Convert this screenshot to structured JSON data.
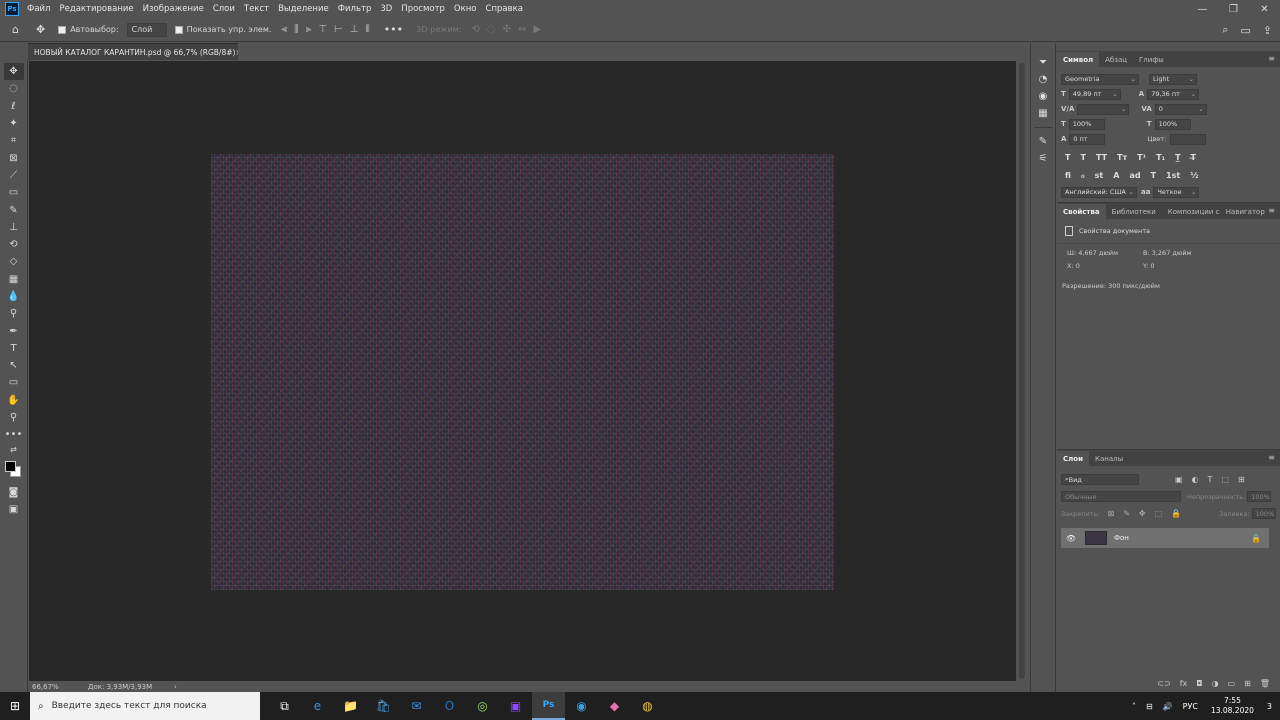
{
  "app": {
    "logo": "Ps"
  },
  "menu": [
    "Файл",
    "Редактирование",
    "Изображение",
    "Слои",
    "Текст",
    "Выделение",
    "Фильтр",
    "3D",
    "Просмотр",
    "Окно",
    "Справка"
  ],
  "window_controls": {
    "minimize": "—",
    "restore": "❐",
    "close": "✕"
  },
  "options": {
    "home_icon": "⌂",
    "move_icon": "✥",
    "autoselect_label": "Автовыбор:",
    "autoselect_value": "Слой",
    "show_controls_label": "Показать упр. элем.",
    "more": "•••",
    "mode_3d": "3D-режим:",
    "search_icon": "⌕",
    "workspace_icon": "▭",
    "share_icon": "⇪"
  },
  "document": {
    "tab_title": "НОВЫЙ КАТАЛОГ КАРАНТИН.psd @ 66,7% (RGB/8#)",
    "close": "×",
    "zoom": "66,67%",
    "doc_info": "Док: 3,93M/3,93M",
    "arrow": "›"
  },
  "character": {
    "tabs": [
      "Символ",
      "Абзац",
      "Глифы"
    ],
    "font_family": "Geometria",
    "font_style": "Light",
    "font_size": "49,89 пт",
    "leading": "79,36 пт",
    "kerning": "",
    "tracking": "0",
    "vertical_scale": "100%",
    "horizontal_scale": "100%",
    "baseline_shift": "0 пт",
    "color_label": "Цвет:",
    "language": "Английский: США",
    "antialias_icon": "aa",
    "antialias": "Четкое",
    "labels": {
      "size": "T",
      "leading": "A",
      "kerning": "V/A",
      "tracking": "VA",
      "vscale": "T",
      "hscale": "T",
      "baseline": "A"
    },
    "typo_row1": [
      "T",
      "T",
      "TT",
      "Tт",
      "T¹",
      "T₁",
      "T̲",
      "T̶"
    ],
    "typo_row2": [
      "fi",
      "ℴ",
      "st",
      "A",
      "ad",
      "T",
      "1st",
      "½"
    ]
  },
  "properties": {
    "tabs": [
      "Свойства",
      "Библиотеки",
      "Композиции слоев",
      "Навигатор"
    ],
    "heading": "Свойства документа",
    "width": "Ш:  4,667 дюйм",
    "height": "В:  3,267 дюйм",
    "x": "X:  0",
    "y": "Y:  0",
    "resolution": "Разрешение: 300 пикс/дюйм"
  },
  "layers": {
    "tabs": [
      "Слои",
      "Каналы"
    ],
    "search_placeholder": "Вид",
    "blend_mode": "Обычные",
    "opacity_label": "Непрозрачность:",
    "opacity": "100%",
    "lock_label": "Закрепить:",
    "fill_label": "Заливка:",
    "fill": "100%",
    "layer_name": "Фон",
    "filter_icons": [
      "▣",
      "◐",
      "T",
      "⬚",
      "⊞"
    ],
    "lock_icons": [
      "⊠",
      "✎",
      "✥",
      "⬚",
      "🔒"
    ],
    "footer_icons": [
      "⊂⊃",
      "fx",
      "◘",
      "◑",
      "▭",
      "⊞",
      "🗑"
    ]
  },
  "taskbar": {
    "start": "⊞",
    "search_placeholder": "Введите здесь текст для поиска",
    "apps": [
      "⧉",
      "e",
      "📁",
      "🛍",
      "✉",
      "O",
      "◎",
      "▣",
      "Ps",
      "◉",
      "◆",
      "◍"
    ],
    "tray": [
      "˄",
      "⊟",
      "🔊"
    ],
    "language": "РУС",
    "time": "7:55",
    "date": "13.08.2020",
    "notif": "3"
  },
  "colors": {
    "ui_panel": "#535353",
    "canvas": "#282828",
    "accent": "#31a8ff"
  }
}
